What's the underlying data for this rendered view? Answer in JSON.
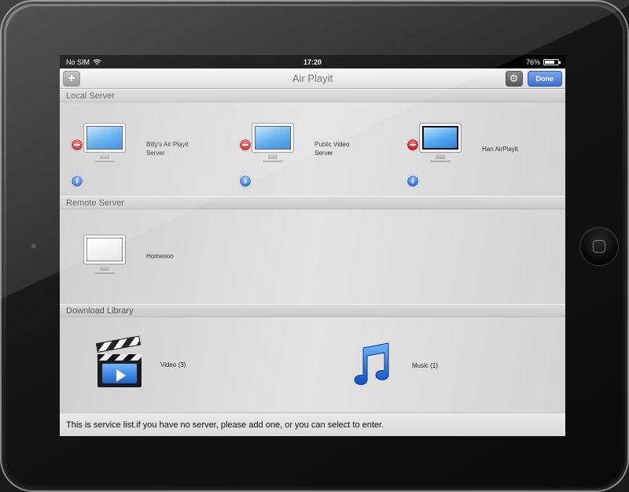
{
  "status_bar": {
    "carrier": "No SIM",
    "time": "17:20",
    "battery": "76%",
    "battery_level": 0.76
  },
  "nav": {
    "title": "Air Playit",
    "add_label": "+",
    "done_label": "Done"
  },
  "sections": {
    "local": "Local Server",
    "remote": "Remote Server",
    "download": "Download Library"
  },
  "local_servers": [
    {
      "name_line1": "Billy's Air Playit",
      "name_line2": "Server"
    },
    {
      "name_line1": "Public Video",
      "name_line2": "Server"
    },
    {
      "name_line1": "Han AirPlayit",
      "name_line2": ""
    }
  ],
  "remote_servers": [
    {
      "name": "Homeooo"
    }
  ],
  "library": {
    "video": "Video (3)",
    "music": "Music (1)"
  },
  "footer": {
    "text": "This is service list.if you have no server, please add one, or you can select to enter."
  },
  "icons": {
    "remove": "minus-circle-icon",
    "info": "info-icon",
    "settings": "gear-icon",
    "computer": "monitor-icon",
    "video": "clapperboard-icon",
    "music": "music-note-icon"
  },
  "colors": {
    "done_button": "#3a6fd1",
    "remove_badge": "#c3141b",
    "info_badge": "#1f5fd2"
  }
}
